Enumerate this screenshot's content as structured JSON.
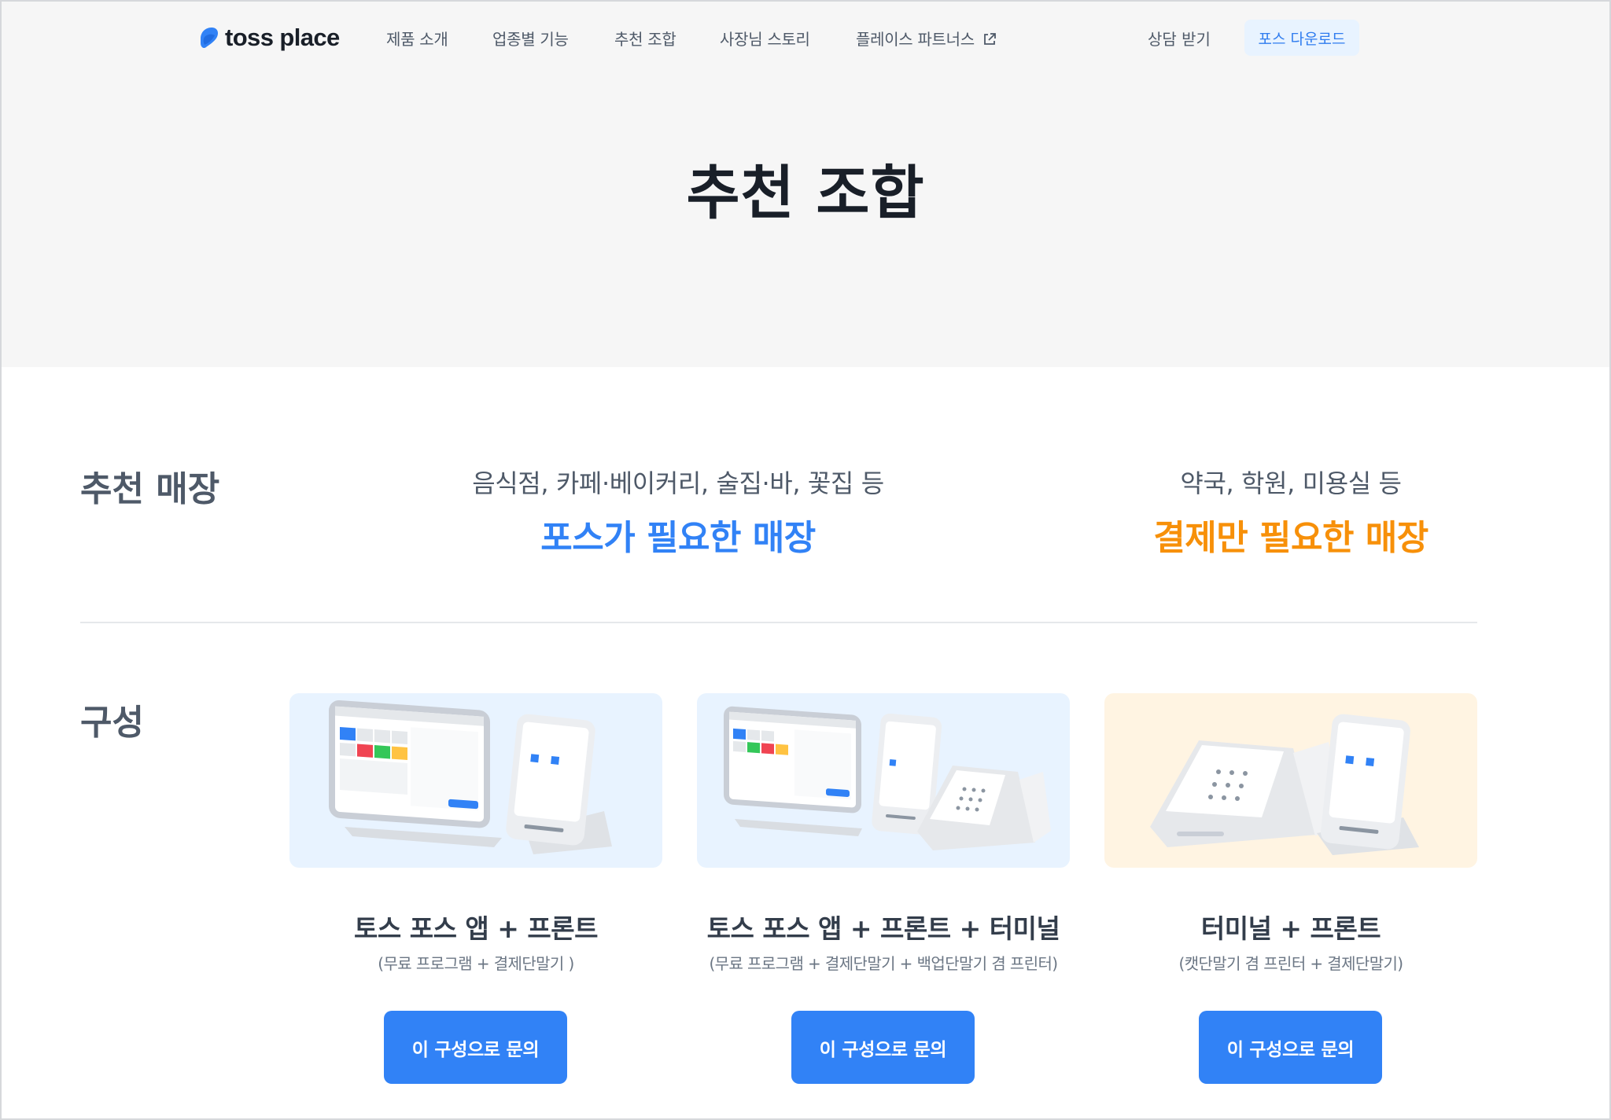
{
  "brand": {
    "name": "toss place",
    "primary_color": "#3182f6",
    "orange_color": "#f79009"
  },
  "nav": {
    "items": [
      "제품 소개",
      "업종별 기능",
      "추천 조합",
      "사장님 스토리",
      "플레이스 파트너스"
    ],
    "external_icon": "external-link-icon",
    "consult_label": "상담 받기",
    "download_label": "포스 다운로드"
  },
  "hero": {
    "title": "추천 조합"
  },
  "stores": {
    "label": "추천 매장",
    "pos": {
      "desc": "음식점, 카페·베이커리, 술집·바, 꽃집 등",
      "heading": "포스가 필요한 매장"
    },
    "payment": {
      "desc": "약국, 학원, 미용실 등",
      "heading": "결제만 필요한 매장"
    }
  },
  "config": {
    "label": "구성",
    "cards": [
      {
        "title": "토스 포스 앱 + 프론트",
        "subtitle": "(무료 프로그램 + 결제단말기 )",
        "button": "이 구성으로 문의",
        "image": "pos-tablet-and-front-device-image"
      },
      {
        "title": "토스 포스 앱 + 프론트 + 터미널",
        "subtitle": "(무료 프로그램 + 결제단말기 + 백업단말기 겸 프린터)",
        "button": "이 구성으로 문의",
        "image": "pos-tablet-front-and-terminal-image"
      },
      {
        "title": "터미널 + 프론트",
        "subtitle": "(캣단말기 겸 프린터 + 결제단말기)",
        "button": "이 구성으로 문의",
        "image": "terminal-and-front-device-image"
      }
    ]
  }
}
